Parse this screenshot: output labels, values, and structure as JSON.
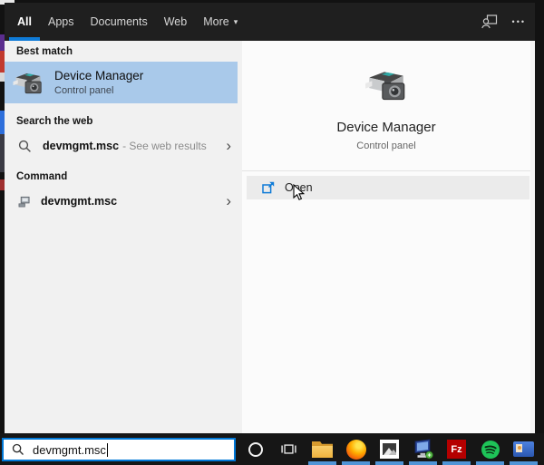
{
  "tabs": {
    "items": [
      {
        "label": "All",
        "active": true
      },
      {
        "label": "Apps",
        "active": false
      },
      {
        "label": "Documents",
        "active": false
      },
      {
        "label": "Web",
        "active": false
      },
      {
        "label": "More",
        "active": false
      }
    ],
    "more_caret": "▾"
  },
  "topbar": {
    "ellipsis": "•••"
  },
  "glyphs": {
    "chevron_right": "›"
  },
  "left_panel": {
    "best_match_label": "Best match",
    "best_match": {
      "title": "Device Manager",
      "subtitle": "Control panel"
    },
    "web_label": "Search the web",
    "web_item": {
      "query": "devmgmt.msc",
      "suffix": "- See web results"
    },
    "command_label": "Command",
    "command_item": {
      "title": "devmgmt.msc"
    }
  },
  "preview": {
    "title": "Device Manager",
    "subtitle": "Control panel",
    "open_label": "Open"
  },
  "search": {
    "value": "devmgmt.msc"
  },
  "taskbar": {
    "filezilla_label": "Fz",
    "icons": [
      "cortana",
      "task-view",
      "file-explorer",
      "firefox",
      "photos",
      "computer",
      "filezilla",
      "spotify",
      "user-accounts"
    ],
    "running_icons": [
      "file-explorer",
      "firefox",
      "photos",
      "computer",
      "filezilla",
      "spotify",
      "user-accounts"
    ]
  },
  "colors": {
    "accent_blue": "#0078d7",
    "tab_underline": "#0f7bd7",
    "best_match_highlight": "#a9c9ea",
    "header_bg": "#1f1f1f",
    "taskbar_bg": "#161616",
    "left_panel_bg": "#f1f1f1",
    "open_row_bg": "#ebebeb",
    "running_indicator": "#4f94d6"
  }
}
